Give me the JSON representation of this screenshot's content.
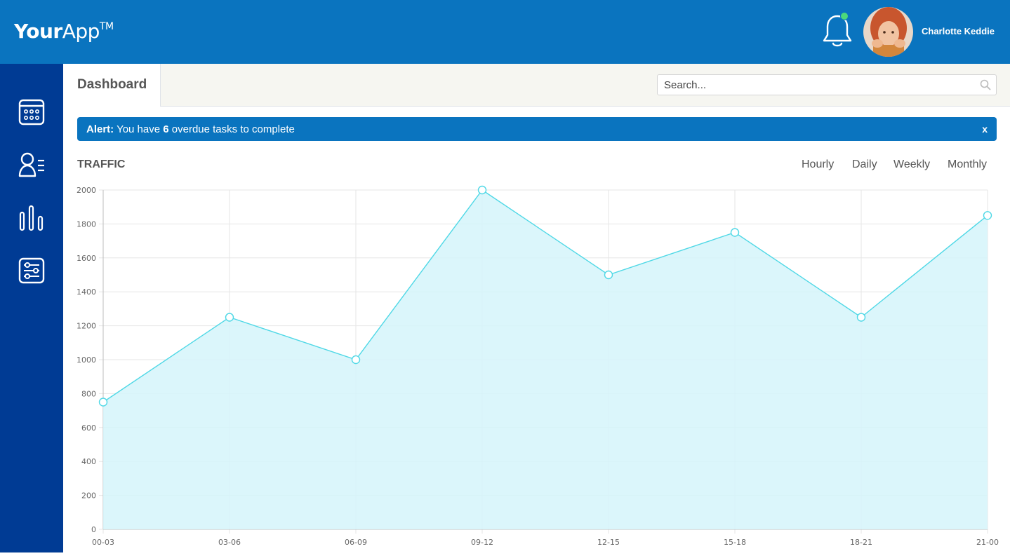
{
  "header": {
    "logo_bold": "Your",
    "logo_light": "App",
    "logo_tm": "TM",
    "user_name": "Charlotte Keddie",
    "notification_indicator_color": "#4cd97b"
  },
  "sidebar": {
    "items": [
      {
        "icon": "calendar-icon"
      },
      {
        "icon": "users-list-icon"
      },
      {
        "icon": "bar-chart-icon"
      },
      {
        "icon": "settings-sliders-icon"
      }
    ]
  },
  "subheader": {
    "tab_label": "Dashboard",
    "search_placeholder": "Search..."
  },
  "alert": {
    "prefix": "Alert:",
    "text_before": " You have ",
    "count": "6",
    "text_after": " overdue tasks to complete",
    "close_label": "x"
  },
  "traffic": {
    "title": "TRAFFIC",
    "periods": [
      "Hourly",
      "Daily",
      "Weekly",
      "Monthly"
    ]
  },
  "colors": {
    "topbar": "#0a74bf",
    "sidebar": "#003b94",
    "line": "#4fd8e6",
    "fill": "#d5f5fa"
  },
  "chart_data": {
    "type": "area",
    "categories": [
      "00-03",
      "03-06",
      "06-09",
      "09-12",
      "12-15",
      "15-18",
      "18-21",
      "21-00"
    ],
    "values": [
      750,
      1250,
      1000,
      2000,
      1500,
      1750,
      1250,
      1850
    ],
    "ylim": [
      0,
      2000
    ],
    "yticks": [
      0,
      200,
      400,
      600,
      800,
      1000,
      1200,
      1400,
      1600,
      1800,
      2000
    ],
    "grid": true,
    "title": "",
    "xlabel": "",
    "ylabel": ""
  }
}
